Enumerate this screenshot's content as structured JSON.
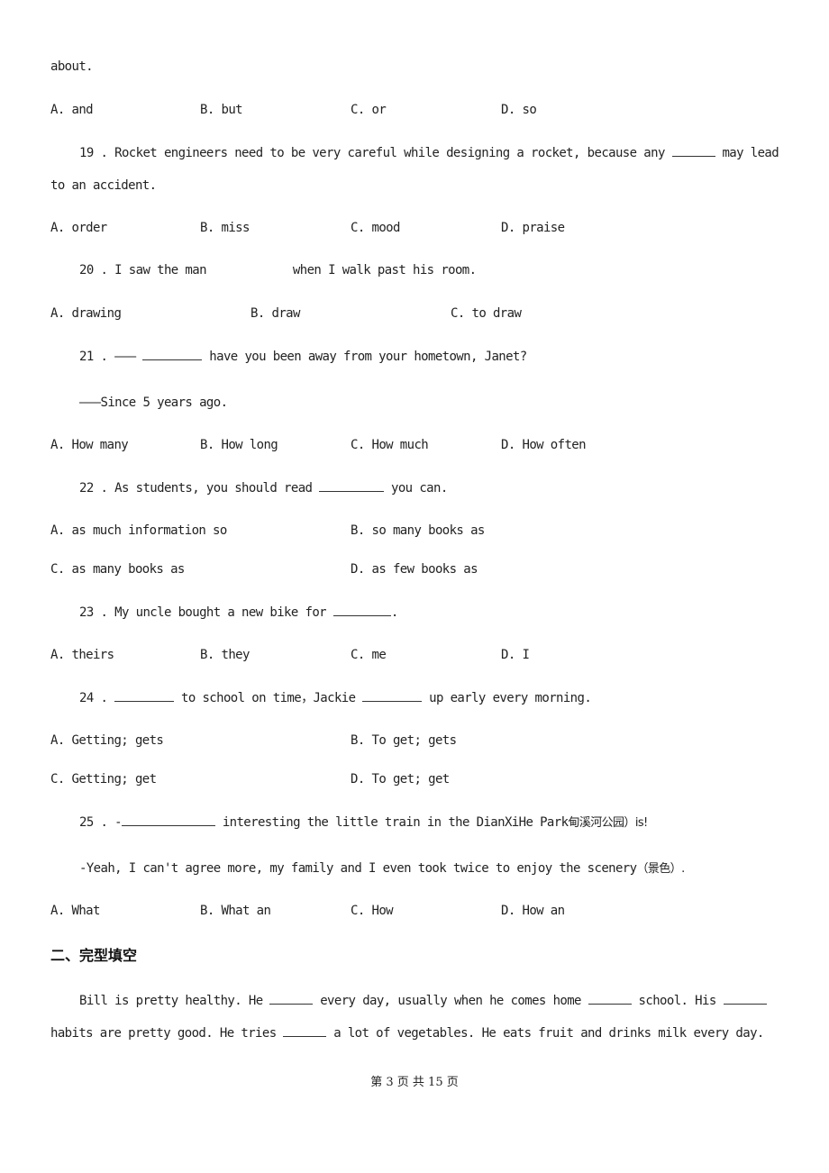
{
  "document": {
    "q18_tail": "about.",
    "q18_options": [
      "A. and",
      "B. but",
      "C. or",
      "D. so"
    ],
    "q19": {
      "prefix": "19 . Rocket engineers need to be very careful while designing a rocket, because any ",
      "suffix": " may lead",
      "line2": "to an accident.",
      "options": [
        "A. order",
        "B. miss",
        "C. mood",
        "D. praise"
      ]
    },
    "q20": {
      "prefix": "20 . I saw the man",
      "suffix": "when I walk past his room.",
      "options": [
        "A. drawing",
        "B. draw",
        "C. to draw"
      ]
    },
    "q21": {
      "prefix": "21 . ——— ",
      "suffix": " have you been away from your hometown, Janet?",
      "reply": "———Since 5 years ago.",
      "options": [
        "A. How many",
        "B. How long",
        "C. How much",
        "D. How often"
      ]
    },
    "q22": {
      "prefix": "22 . As students, you should read ",
      "suffix": " you can.",
      "options": [
        "A. as much information so",
        "B. so many books as",
        "C. as many books as",
        "D. as few books as"
      ]
    },
    "q23": {
      "prefix": "23 . My uncle bought a new bike for ",
      "suffix": ".",
      "options": [
        "A. theirs",
        "B. they",
        "C. me",
        "D. I"
      ]
    },
    "q24": {
      "prefix": "24 . ",
      "middle": " to school on time，Jackie ",
      "suffix": " up early every morning.",
      "options": [
        "A. Getting; gets",
        "B. To get; gets",
        "C. Getting; get",
        "D. To get; get"
      ]
    },
    "q25": {
      "prefix": "25 . -",
      "suffix": " interesting the little train in the DianXiHe Park",
      "cn": "甸溪河公园）is!",
      "reply": "-Yeah, I can't agree more, my family and I even took twice to enjoy the scenery",
      "reply_cn": "（景色）.",
      "options": [
        "A. What",
        "B. What an",
        "C. How",
        "D. How an"
      ]
    },
    "section2": {
      "heading": "二、完型填空",
      "p1_a": "Bill is pretty healthy. He ",
      "p1_b": " every day, usually when he comes home ",
      "p1_c": " school. His ",
      "p2_a": "habits are pretty good. He tries ",
      "p2_b": " a lot of vegetables. He eats fruit and drinks milk every day."
    },
    "footer": "第 3 页 共 15 页"
  }
}
